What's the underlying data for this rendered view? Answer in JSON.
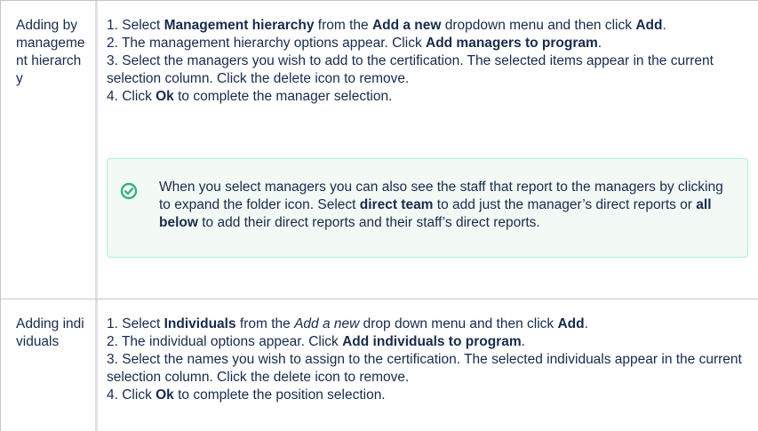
{
  "rows": [
    {
      "label": "Adding by management hierarchy",
      "steps": [
        {
          "num": "1. ",
          "parts": [
            {
              "t": "Select ",
              "b": false
            },
            {
              "t": "Management hierarchy",
              "b": true
            },
            {
              "t": " from the ",
              "b": false
            },
            {
              "t": "Add a new",
              "b": true
            },
            {
              "t": " dropdown menu and then click ",
              "b": false
            },
            {
              "t": "Add",
              "b": true
            },
            {
              "t": ".",
              "b": false
            }
          ]
        },
        {
          "num": "2. ",
          "parts": [
            {
              "t": "The management hierarchy options appear. Click ",
              "b": false
            },
            {
              "t": "Add managers to program",
              "b": true
            },
            {
              "t": ".",
              "b": false
            }
          ]
        },
        {
          "num": "3. ",
          "parts": [
            {
              "t": "Select the managers you wish to add to the certification. The selected items appear in the current selection column. Click the delete icon to remove.",
              "b": false
            }
          ]
        },
        {
          "num": "4. ",
          "parts": [
            {
              "t": "Click ",
              "b": false
            },
            {
              "t": "Ok",
              "b": true
            },
            {
              "t": " to complete the manager selection.",
              "b": false
            }
          ]
        }
      ],
      "tip": {
        "icon": "check-circle-icon",
        "parts": [
          {
            "t": "When you select managers you can also see the staff that report to the managers by clicking to expand the folder icon. Select ",
            "b": false
          },
          {
            "t": "direct team",
            "b": true
          },
          {
            "t": " to add just the manager’s direct reports or ",
            "b": false
          },
          {
            "t": "all below",
            "b": true
          },
          {
            "t": " to add their direct reports and their staff’s direct reports.",
            "b": false
          }
        ]
      }
    },
    {
      "label": "Adding individuals",
      "steps": [
        {
          "num": "1. ",
          "parts": [
            {
              "t": "Select ",
              "b": false
            },
            {
              "t": "Individuals",
              "b": true
            },
            {
              "t": " from the ",
              "b": false
            },
            {
              "t": "Add a new",
              "i": true
            },
            {
              "t": " drop down menu and then click ",
              "b": false
            },
            {
              "t": "Add",
              "b": true
            },
            {
              "t": ".",
              "b": false
            }
          ]
        },
        {
          "num": "2. ",
          "parts": [
            {
              "t": "The individual options appear. Click ",
              "b": false
            },
            {
              "t": "Add individuals to program",
              "b": true
            },
            {
              "t": ".",
              "b": false
            }
          ]
        },
        {
          "num": "3. ",
          "parts": [
            {
              "t": "Select the names you wish to assign to the certification. The selected individuals appear in the current selection column. Click the delete icon to remove.",
              "b": false
            }
          ]
        },
        {
          "num": "4. ",
          "parts": [
            {
              "t": "Click ",
              "b": false
            },
            {
              "t": "Ok",
              "b": true
            },
            {
              "t": " to complete the position selection.",
              "b": false
            }
          ]
        }
      ]
    }
  ],
  "colors": {
    "text": "#172b4d",
    "border": "#c1c7d0",
    "tip_border": "#abf5d1",
    "tip_bg": "#f3f9f4",
    "tip_icon": "#36b37e"
  }
}
